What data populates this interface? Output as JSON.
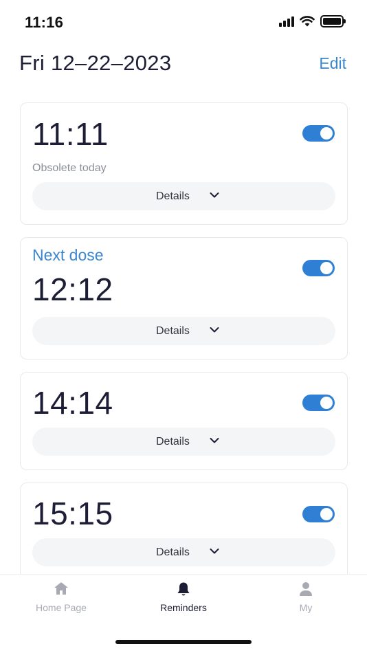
{
  "status_bar": {
    "time": "11:16",
    "signal_icon": "cellular-signal-icon",
    "wifi_icon": "wifi-icon",
    "battery_icon": "battery-icon"
  },
  "header": {
    "date": "Fri 12–22–2023",
    "edit_label": "Edit"
  },
  "reminders": [
    {
      "time": "11:11",
      "subtext": "Obsolete today",
      "enabled": true,
      "details_label": "Details"
    },
    {
      "label": "Next dose",
      "time": "12:12",
      "enabled": true,
      "details_label": "Details"
    },
    {
      "time": "14:14",
      "enabled": true,
      "details_label": "Details"
    },
    {
      "time": "15:15",
      "enabled": true,
      "details_label": "Details"
    }
  ],
  "tab_bar": {
    "tabs": [
      {
        "label": "Home Page",
        "icon": "home-icon",
        "active": false
      },
      {
        "label": "Reminders",
        "icon": "bell-icon",
        "active": true
      },
      {
        "label": "My",
        "icon": "person-icon",
        "active": false
      }
    ]
  },
  "colors": {
    "accent": "#3a86d0",
    "toggle_on": "#2f7fd4",
    "text_primary": "#1d1d35",
    "text_muted": "#8c8f99",
    "tab_inactive": "#a7aab2",
    "details_bg": "#f4f5f7"
  }
}
